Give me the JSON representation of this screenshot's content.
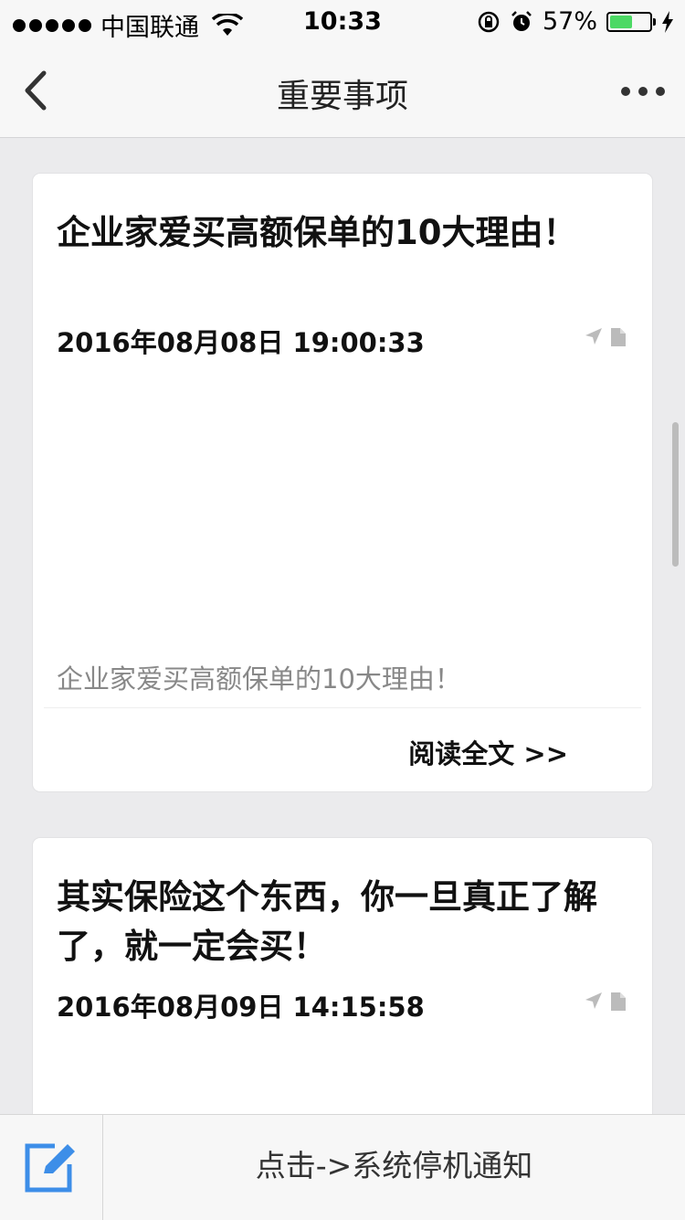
{
  "status_bar": {
    "carrier": "中国联通",
    "time": "10:33",
    "battery_percent": "57%",
    "battery_level": 0.57
  },
  "nav": {
    "title": "重要事项",
    "back_icon": "chevron-left-icon",
    "more_icon": "more-dots-icon"
  },
  "articles": [
    {
      "title": "企业家爱买高额保单的10大理由！",
      "date": "2016年08月08日 19:00:33",
      "summary": "企业家爱买高额保单的10大理由！",
      "read_more": "阅读全文 >>"
    },
    {
      "title": "其实保险这个东西，你一旦真正了解了，就一定会买！",
      "date": "2016年08月09日 14:15:58"
    }
  ],
  "bottom_bar": {
    "compose_icon": "edit-icon",
    "notice_label": "点击->系统停机通知"
  },
  "colors": {
    "background": "#ebebed",
    "bar": "#f7f7f7",
    "accent": "#3d8ee8",
    "battery": "#4cd964"
  }
}
